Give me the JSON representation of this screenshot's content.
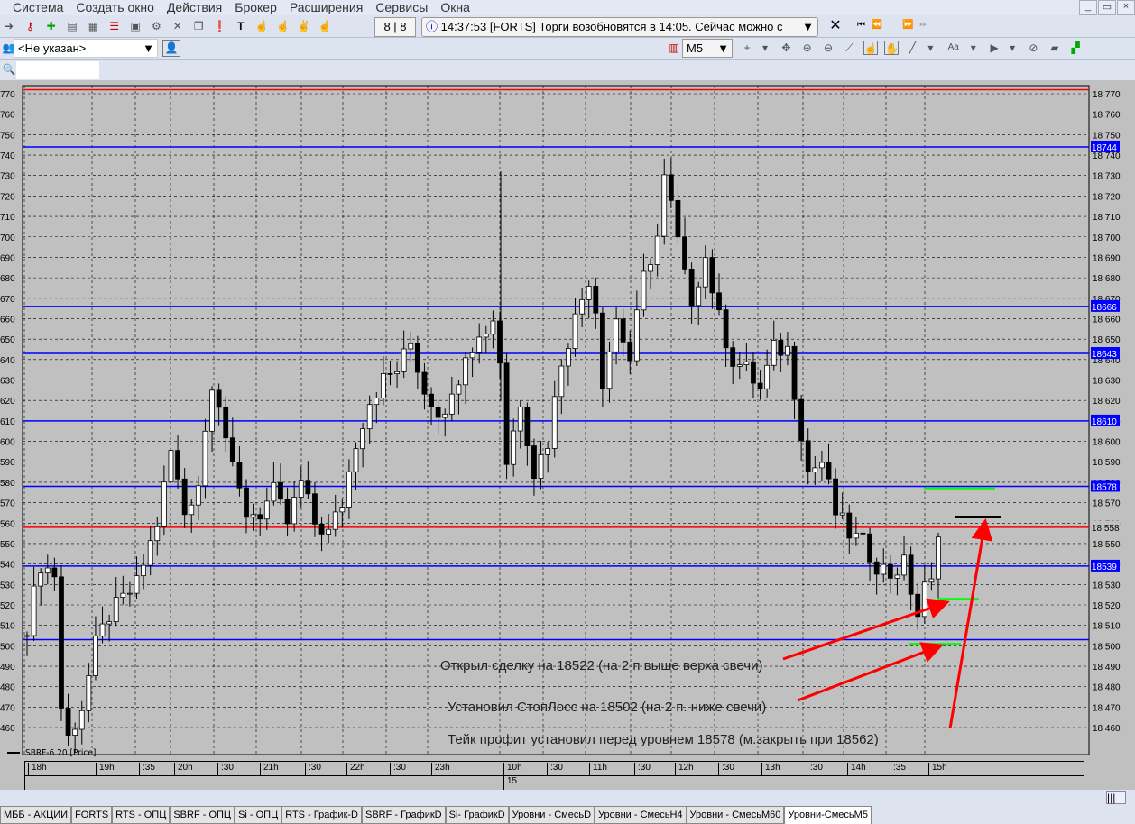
{
  "menu": [
    "Система",
    "Создать окно",
    "Действия",
    "Брокер",
    "Расширения",
    "Сервисы",
    "Окна"
  ],
  "window_buttons": [
    "_",
    "▭",
    "×"
  ],
  "toolbar": {
    "counter": "8 | 8",
    "message": "14:37:53  [FORTS] Торги возобновятся в 14:05. Сейчас можно с",
    "account": "<Не указан>",
    "search_value": "",
    "timeframe": "M5",
    "font_btn": "Aa"
  },
  "legend": "SBRF-6.20 [Price]",
  "time_labels": [
    {
      "t": "18h",
      "x": 30
    },
    {
      "t": "19h",
      "x": 105
    },
    {
      "t": ":35",
      "x": 153
    },
    {
      "t": "20h",
      "x": 192
    },
    {
      "t": ":30",
      "x": 240
    },
    {
      "t": "21h",
      "x": 287
    },
    {
      "t": ":30",
      "x": 337
    },
    {
      "t": "22h",
      "x": 383
    },
    {
      "t": ":30",
      "x": 431
    },
    {
      "t": "23h",
      "x": 477
    },
    {
      "t": "10h",
      "x": 557
    },
    {
      "t": ":30",
      "x": 605
    },
    {
      "t": "11h",
      "x": 652
    },
    {
      "t": ":30",
      "x": 702
    },
    {
      "t": "12h",
      "x": 747
    },
    {
      "t": ":30",
      "x": 795
    },
    {
      "t": "13h",
      "x": 843
    },
    {
      "t": ":30",
      "x": 893
    },
    {
      "t": "14h",
      "x": 938
    },
    {
      "t": ":35",
      "x": 985
    },
    {
      "t": "15h",
      "x": 1028
    }
  ],
  "date_label": "15",
  "tabs": [
    "МББ - АКЦИИ",
    "FORTS",
    "RTS - ОПЦ",
    "SBRF - ОПЦ",
    "Si - ОПЦ",
    "RTS - График-D",
    "SBRF - ГрафикD",
    "Si- ГрафикD",
    "Уровни - СмесьD",
    "Уровни - СмесьН4",
    "Уровни - СмесьМ60",
    "Уровни-СмесьМ5"
  ],
  "active_tab": 11,
  "chart_data": {
    "type": "candlestick",
    "instrument": "SBRF-6.20",
    "ylim": [
      18455,
      18772
    ],
    "y_ticks_step": 10,
    "levels": [
      {
        "price": 18772,
        "color": "#ff0000",
        "label": ""
      },
      {
        "price": 18744,
        "color": "#0000ff",
        "label": "18744"
      },
      {
        "price": 18666,
        "color": "#0000ff",
        "label": "18666"
      },
      {
        "price": 18643,
        "color": "#0000ff",
        "label": "18643"
      },
      {
        "price": 18610,
        "color": "#0000ff",
        "label": "18610"
      },
      {
        "price": 18578,
        "color": "#0000ff",
        "label": "18578"
      },
      {
        "price": 18558,
        "color": "#ff0000",
        "label": "18 558"
      },
      {
        "price": 18539,
        "color": "#0000ff",
        "label": "18539"
      },
      {
        "price": 18503,
        "color": "#0000ff",
        "label": ""
      }
    ],
    "close_path": [
      [
        0,
        18510
      ],
      [
        2,
        18540
      ],
      [
        4,
        18535
      ],
      [
        5,
        18470
      ],
      [
        6,
        18455
      ],
      [
        8,
        18470
      ],
      [
        10,
        18500
      ],
      [
        12,
        18515
      ],
      [
        16,
        18530
      ],
      [
        19,
        18560
      ],
      [
        21,
        18595
      ],
      [
        23,
        18565
      ],
      [
        25,
        18580
      ],
      [
        27,
        18630
      ],
      [
        28,
        18620
      ],
      [
        30,
        18585
      ],
      [
        32,
        18565
      ],
      [
        34,
        18565
      ],
      [
        36,
        18575
      ],
      [
        38,
        18560
      ],
      [
        40,
        18580
      ],
      [
        42,
        18560
      ],
      [
        44,
        18555
      ],
      [
        46,
        18570
      ],
      [
        48,
        18600
      ],
      [
        50,
        18620
      ],
      [
        52,
        18630
      ],
      [
        54,
        18635
      ],
      [
        56,
        18648
      ],
      [
        58,
        18625
      ],
      [
        60,
        18615
      ],
      [
        62,
        18620
      ],
      [
        64,
        18645
      ],
      [
        66,
        18650
      ],
      [
        68,
        18660
      ],
      [
        69,
        18640
      ],
      [
        70,
        18590
      ],
      [
        72,
        18620
      ],
      [
        74,
        18585
      ],
      [
        76,
        18600
      ],
      [
        78,
        18640
      ],
      [
        80,
        18660
      ],
      [
        82,
        18680
      ],
      [
        83,
        18665
      ],
      [
        84,
        18630
      ],
      [
        86,
        18660
      ],
      [
        88,
        18640
      ],
      [
        90,
        18680
      ],
      [
        92,
        18700
      ],
      [
        93,
        18728
      ],
      [
        94,
        18715
      ],
      [
        96,
        18680
      ],
      [
        97,
        18670
      ],
      [
        99,
        18690
      ],
      [
        101,
        18660
      ],
      [
        103,
        18640
      ],
      [
        105,
        18635
      ],
      [
        107,
        18625
      ],
      [
        109,
        18645
      ],
      [
        111,
        18645
      ],
      [
        113,
        18605
      ],
      [
        114,
        18585
      ],
      [
        116,
        18590
      ],
      [
        118,
        18565
      ],
      [
        120,
        18555
      ],
      [
        122,
        18550
      ],
      [
        124,
        18540
      ],
      [
        126,
        18535
      ],
      [
        128,
        18540
      ],
      [
        130,
        18515
      ],
      [
        131,
        18528
      ],
      [
        132,
        18530
      ],
      [
        133,
        18558
      ]
    ],
    "candle_count": 134,
    "annotations": [
      "Открыл сделку на 18522 (на 2 п выше верха свечи)",
      "Установил СтопЛосс на 18502 (на 2 п. ниже свечи)",
      "Тейк профит установил перед уровнем 18578 (м.закрыть при 18562)"
    ],
    "trade_marks": [
      {
        "price": 18577,
        "color": "#00ff00"
      },
      {
        "price": 18523,
        "color": "#00ff00"
      },
      {
        "price": 18501,
        "color": "#00ff00"
      },
      {
        "price": 18563,
        "color": "#000000"
      }
    ]
  }
}
